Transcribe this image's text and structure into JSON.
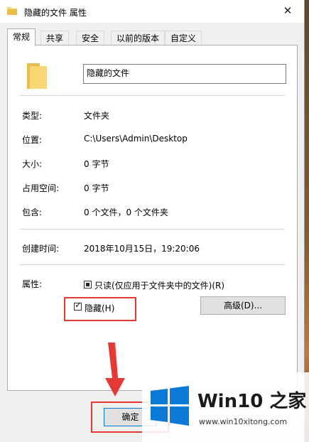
{
  "window": {
    "title": "隐藏的文件 属性",
    "close_glyph": "✕"
  },
  "tabs": [
    {
      "label": "常规",
      "active": true
    },
    {
      "label": "共享"
    },
    {
      "label": "安全"
    },
    {
      "label": "以前的版本"
    },
    {
      "label": "自定义"
    }
  ],
  "general": {
    "name": "隐藏的文件",
    "rows": [
      {
        "label": "类型:",
        "value": "文件夹"
      },
      {
        "label": "位置:",
        "value": "C:\\Users\\Admin\\Desktop"
      },
      {
        "label": "大小:",
        "value": "0 字节"
      },
      {
        "label": "占用空间:",
        "value": "0 字节"
      },
      {
        "label": "包含:",
        "value": "0 个文件，0 个文件夹"
      }
    ],
    "created_label": "创建时间:",
    "created_value": "2018年10月15日，19:20:06",
    "attributes_label": "属性:",
    "readonly_label": "只读(仅应用于文件夹中的文件)(R)",
    "readonly_state": "indeterminate",
    "hidden_label": "隐藏(H)",
    "hidden_checked": true,
    "advanced_label": "高级(D)..."
  },
  "buttons": {
    "ok_label": "确定"
  },
  "watermark": {
    "title": "Win10 之家",
    "url": "www.win10xitong.com"
  },
  "colors": {
    "highlight": "#e53935",
    "folder": "#f7d674",
    "win_blue": "#0a7ad6"
  }
}
